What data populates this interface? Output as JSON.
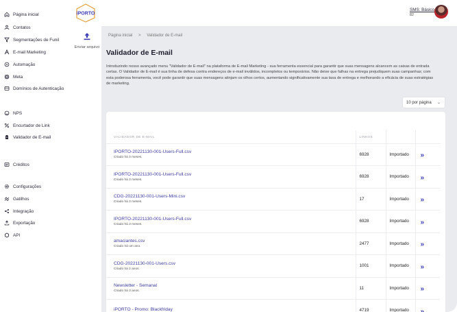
{
  "sidebar": {
    "items": [
      {
        "label": "Página inicial",
        "icon": "home-icon"
      },
      {
        "label": "Contatos",
        "icon": "contacts-icon"
      },
      {
        "label": "Segmentações de Funil",
        "icon": "funnel-icon"
      },
      {
        "label": "E-mail Marketing",
        "icon": "email-marketing-icon"
      },
      {
        "label": "Automação",
        "icon": "automation-icon"
      },
      {
        "label": "Meta",
        "icon": "meta-icon"
      },
      {
        "label": "Domínios de Autenticação",
        "icon": "domain-icon"
      },
      {
        "label": "NPS",
        "icon": "nps-icon"
      },
      {
        "label": "Encurtador de Link",
        "icon": "link-icon"
      },
      {
        "label": "Validador de E-mail",
        "icon": "validator-icon"
      },
      {
        "label": "Créditos",
        "icon": "credits-icon"
      },
      {
        "label": "Configurações",
        "icon": "settings-icon"
      },
      {
        "label": "Gatilhos",
        "icon": "trigger-icon"
      },
      {
        "label": "Integração",
        "icon": "integration-icon"
      },
      {
        "label": "Exportação",
        "icon": "export-icon"
      },
      {
        "label": "API",
        "icon": "api-icon"
      }
    ]
  },
  "brand": {
    "logo_text": "iPORTO",
    "accent": "#3b3bb5"
  },
  "header": {
    "plan_label": "SMS: Básico",
    "account_id": "82"
  },
  "upload": {
    "label": "Enviar arquivo"
  },
  "breadcrumb": {
    "home": "Página inicial",
    "separator": ">",
    "current": "Validador de E-mail"
  },
  "page": {
    "title": "Validador de E-mail",
    "intro": "Introduzindo nosso avançado menu \"Validador de E-mail\" na plataforma de E-mail Marketing - sua ferramenta essencial para garantir que suas mensagens alcancem as caixas de entrada certas. O Validador de E-mail é sua linha de defesa contra endereços de e-mail inválidos, incompletos ou temporários. Não deixe que falhas na entrega prejudiquem suas campanhas; com esta poderosa ferramenta, você pode garantir que suas mensagens atinjam os olhos certos, aumentando significativamente sua taxa de entrega e melhorando a eficácia de suas estratégias de marketing.",
    "per_page": "10 por página"
  },
  "table": {
    "headers": {
      "name": "VALIDADOR DE E-MAIL",
      "lines": "LINHAS"
    },
    "rows": [
      {
        "name": "IPORTO-20221130-001-Users-Full.csv",
        "created": "Criado há 3 meses.",
        "lines": "6928",
        "status": "Importado"
      },
      {
        "name": "IPORTO-20221130-001-Users-Full.csv",
        "created": "Criado há 3 meses.",
        "lines": "6928",
        "status": "Importado"
      },
      {
        "name": "CDG-20221130-001-Users-Mini.csv",
        "created": "Criado há 3 meses.",
        "lines": "17",
        "status": "Importado"
      },
      {
        "name": "IPORTO-20221130-001-Users-Full.csv",
        "created": "Criado há 3 meses.",
        "lines": "6928",
        "status": "Importado"
      },
      {
        "name": "amaciantes.csv",
        "created": "Criado há um ano.",
        "lines": "2477",
        "status": "Importado"
      },
      {
        "name": "CDG-20221130-001-Users.csv",
        "created": "Criado há 2 anos.",
        "lines": "1001",
        "status": "Importado"
      },
      {
        "name": "Newsletter - Semanal",
        "created": "Criado há 3 anos.",
        "lines": "11",
        "status": "Importado"
      },
      {
        "name": "iPORTO - Promo: Blackfriday",
        "created": "",
        "lines": "4719",
        "status": "Importado"
      }
    ],
    "go_glyph": "»"
  }
}
